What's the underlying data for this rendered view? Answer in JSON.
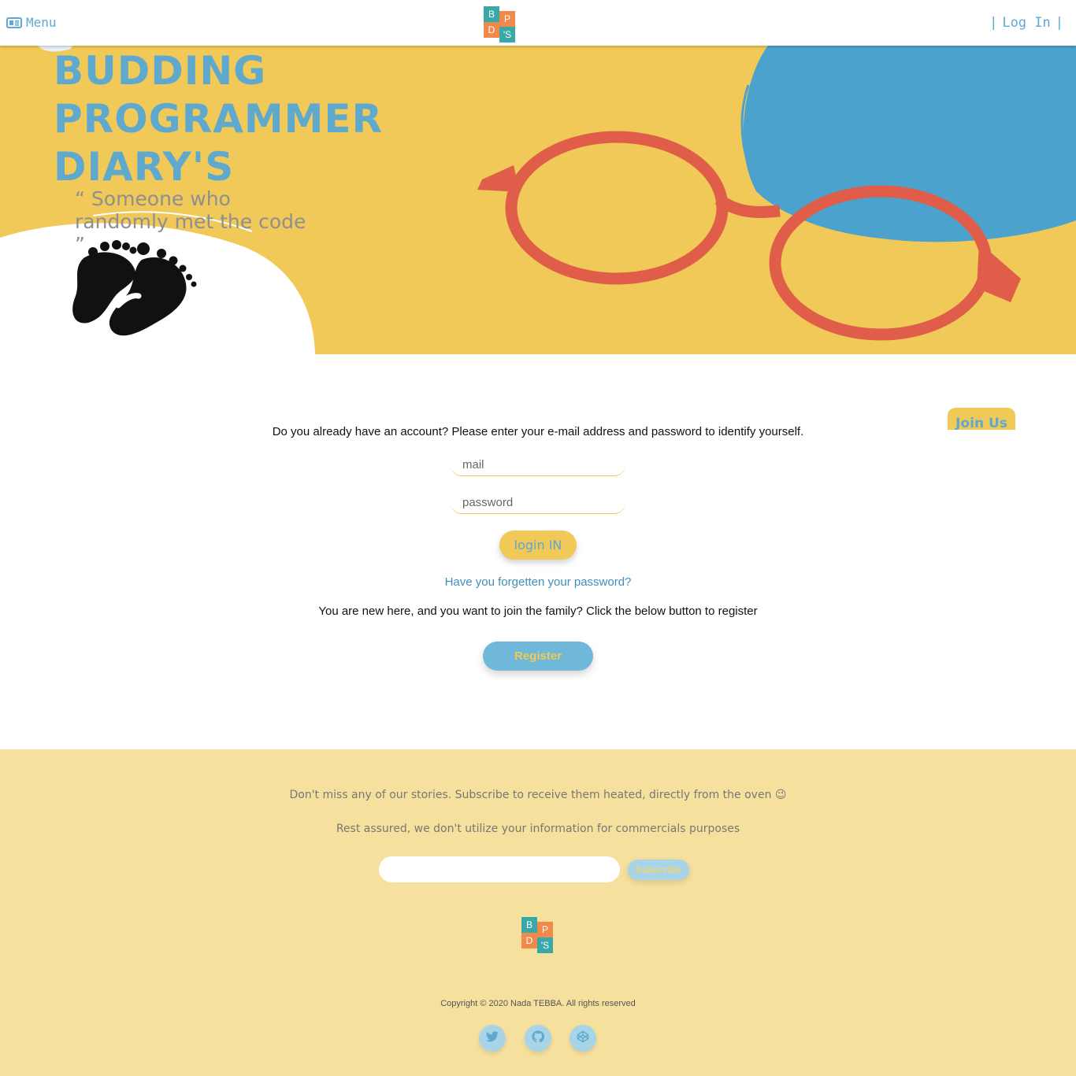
{
  "header": {
    "menu_label": "Menu",
    "login_label": "Log In",
    "logo_letters": [
      "B",
      "P",
      "D",
      "'S"
    ]
  },
  "hero": {
    "title_lines": [
      "BUDDING",
      "PROGRAMMER",
      "DIARY'S"
    ],
    "tagline": "“ Someone who randomly met the code ”"
  },
  "join_tab_label": "Join Us",
  "login": {
    "intro": "Do you already have an account? Please enter your e-mail address and password to identify yourself.",
    "mail_placeholder": "mail",
    "password_placeholder": "password",
    "button_label": "login IN",
    "forgot_label": "Have you forgetten your password?",
    "register_prompt": "You are new here, and you want to join the family? Click the below button to register",
    "register_label": "Register"
  },
  "footer": {
    "subscribe_text": "Don't miss any of our stories. Subscribe to receive them heated, directly from the oven 😉",
    "privacy_text": "Rest assured, we don't utilize your information for commercials purposes",
    "subscribe_input_value": "",
    "subscribe_button_label": "Subscribe",
    "copyright": "Copyright © 2020 Nada TEBBA. All rights reserved",
    "social_icons": [
      "twitter-icon",
      "github-icon",
      "codepen-icon"
    ]
  },
  "colors": {
    "brand_yellow": "#f0c958",
    "brand_blue": "#5fa9cf",
    "glasses_red": "#e05d4a",
    "footer_bg": "#f6e09e",
    "logo_teal": "#3aa8a8",
    "logo_orange": "#f08a4b"
  }
}
